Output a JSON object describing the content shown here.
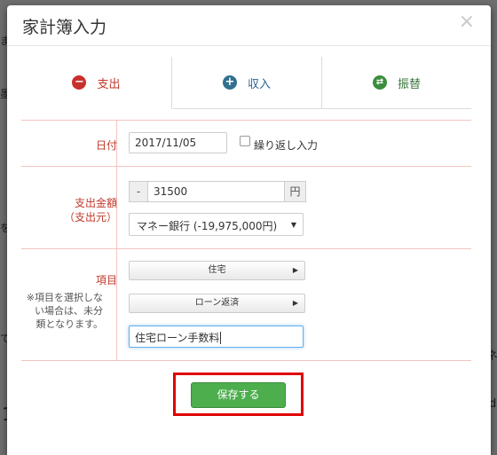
{
  "background": {
    "frag_1": "ま",
    "frag_2": "墨",
    "frag_3": "を",
    "frag_4": "で",
    "frag_5": "1",
    "frag_6": "ネ",
    "frag_7": "d"
  },
  "modal": {
    "title": "家計簿入力",
    "close": "×"
  },
  "tabs": [
    {
      "label": "支出",
      "icon": "minus-circle-icon",
      "color": "#c0392b",
      "active": true
    },
    {
      "label": "収入",
      "icon": "plus-circle-icon",
      "color": "#2a6496"
    },
    {
      "label": "振替",
      "icon": "swap-circle-icon",
      "color": "#3c763d"
    }
  ],
  "date": {
    "label": "日付",
    "value": "2017/11/05",
    "repeat_label": "繰り返し入力"
  },
  "amount": {
    "label": "支出金額",
    "sub_label": "（支出元）",
    "sign": "-",
    "value": "31500",
    "unit": "円",
    "account": "マネー銀行 (-19,975,000円)"
  },
  "category": {
    "label": "項目",
    "note": "※項目を選択しない場合は、未分類となります。",
    "note_lines": [
      "※項目を選択しな",
      "い場合は、未分",
      "類となります。"
    ],
    "major": "住宅",
    "minor": "ローン返済",
    "memo": "住宅ローン手数料"
  },
  "actions": {
    "save_label": "保存する"
  },
  "colors": {
    "accent_red": "#c0392b",
    "save_green": "#4cae4c",
    "highlight": "#e00000"
  }
}
